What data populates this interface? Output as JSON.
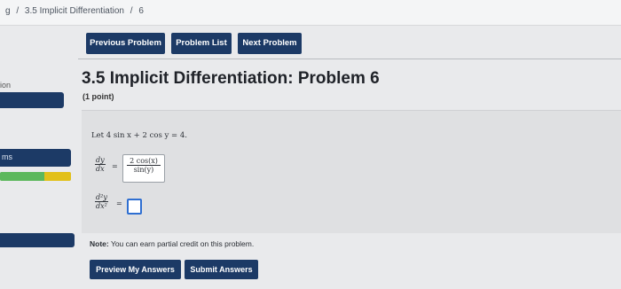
{
  "breadcrumb": {
    "prefix": "g",
    "sep1": "/",
    "section": "3.5 Implicit Differentiation",
    "sep2": "/",
    "problem": "6"
  },
  "sidebar": {
    "top_label": "ion",
    "menu_label": "ms",
    "progress": {
      "green_fraction": 0.62,
      "yellow_fraction": 0.38
    }
  },
  "nav": {
    "previous_label": "Previous Problem",
    "list_label": "Problem List",
    "next_label": "Next Problem"
  },
  "problem": {
    "title": "3.5 Implicit Differentiation: Problem 6",
    "points": "(1 point)",
    "statement": "Let 4 sin x + 2 cos y = 4.",
    "q1": {
      "num": "dy",
      "den": "dx",
      "eq": "="
    },
    "q1_answer": {
      "num": "2 cos(x)",
      "den": "sin(y)"
    },
    "q2": {
      "num": "d²y",
      "den": "dx²",
      "eq": "="
    },
    "note_bold": "Note:",
    "note_text": " You can earn partial credit on this problem."
  },
  "actions": {
    "preview_label": "Preview My Answers",
    "submit_label": "Submit Answers"
  },
  "colors": {
    "button_bg": "#1c3a66",
    "focus_border": "#2f6fd1",
    "progress_green": "#5cb85c",
    "progress_yellow": "#e2c019"
  }
}
